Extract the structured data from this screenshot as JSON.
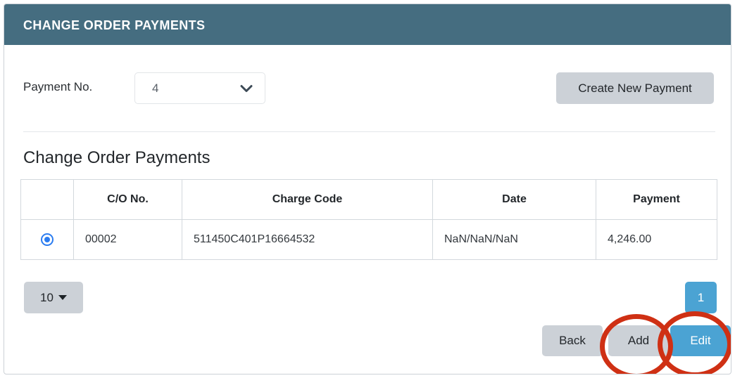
{
  "card": {
    "header_title": "CHANGE ORDER PAYMENTS",
    "header_color": "#456d80"
  },
  "payment_selector": {
    "label": "Payment No.",
    "value": "4",
    "caret_icon": "chevron-down-icon",
    "create_button_label": "Create New Payment"
  },
  "section": {
    "title": "Change Order Payments"
  },
  "table": {
    "columns": [
      "",
      "C/O No.",
      "Charge Code",
      "Date",
      "Payment"
    ],
    "rows": [
      {
        "selected": true,
        "co_no": "00002",
        "charge_code": "511450C401P16664532",
        "date": "NaN/NaN/NaN",
        "payment": "4,246.00"
      }
    ]
  },
  "footer": {
    "page_size_value": "10",
    "page_size_caret_icon": "caret-down-icon",
    "pagination_pages": [
      "1"
    ],
    "active_page": "1",
    "back_label": "Back",
    "add_label": "Add",
    "edit_label": "Edit"
  },
  "annotations": {
    "color": "#cf3014",
    "circles": [
      {
        "target": "add-button"
      },
      {
        "target": "edit-button"
      }
    ]
  },
  "colors": {
    "header_bar": "#456d80",
    "primary_blue": "#4ba3d3",
    "secondary_gray": "#ccd1d7",
    "radio_blue": "#2b7cf0",
    "annotation_red": "#cf3014"
  }
}
